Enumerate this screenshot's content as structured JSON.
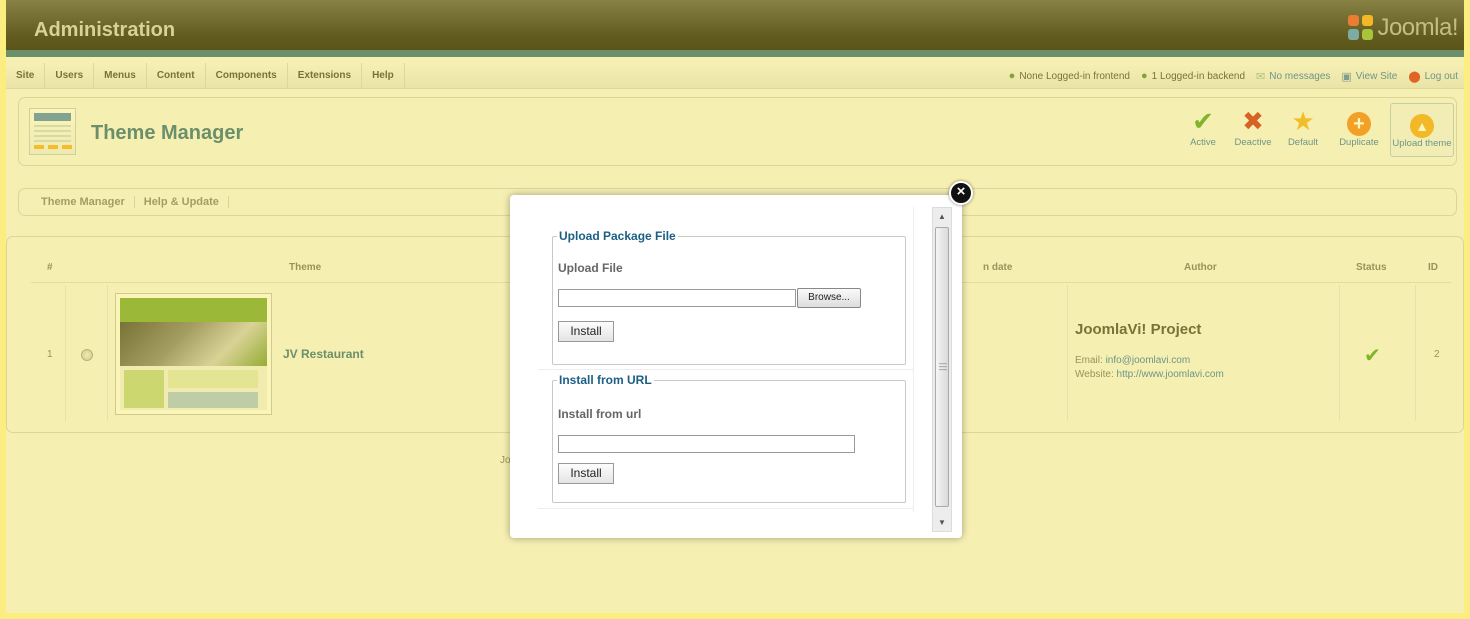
{
  "header": {
    "title": "Administration",
    "logo_text": "Joomla!"
  },
  "menu": {
    "items": [
      "Site",
      "Users",
      "Menus",
      "Content",
      "Components",
      "Extensions",
      "Help"
    ]
  },
  "status_bar": {
    "frontend": "None Logged-in frontend",
    "backend": "1 Logged-in backend",
    "messages": "No messages",
    "view_site": "View Site",
    "logout": "Log out"
  },
  "toolbar": {
    "title": "Theme Manager",
    "buttons": [
      {
        "label": "Active",
        "icon": "checkmark-icon"
      },
      {
        "label": "Deactive",
        "icon": "cross-icon"
      },
      {
        "label": "Default",
        "icon": "star-icon"
      },
      {
        "label": "Duplicate",
        "icon": "plus-circle-icon"
      },
      {
        "label": "Upload theme",
        "icon": "upload-circle-icon"
      }
    ]
  },
  "submenu": {
    "items": [
      "Theme Manager",
      "Help & Update"
    ]
  },
  "table": {
    "headers": {
      "num": "#",
      "theme": "Theme",
      "date": "n date",
      "author": "Author",
      "status": "Status",
      "id": "ID"
    },
    "rows": [
      {
        "num": "1",
        "theme": "JV Restaurant",
        "author": "JoomlaVi! Project",
        "email_label": "Email:",
        "email": "info@joomlavi.com",
        "website_label": "Website:",
        "website": "http://www.joomlavi.com",
        "id": "2"
      }
    ]
  },
  "footer": {
    "fragment": "Jo"
  },
  "modal": {
    "upload_legend": "Upload Package File",
    "upload_label": "Upload File",
    "browse_label": "Browse...",
    "install_label": "Install",
    "url_legend": "Install from URL",
    "url_label": "Install from url",
    "url_install_label": "Install",
    "close_glyph": "×"
  },
  "colors": {
    "brand": "#1b5f84",
    "link": "#1e6ab0",
    "active": "#3c9a22",
    "deactive": "#c41a1a",
    "default": "#f0a91e",
    "duplicate": "#ef7d1a"
  }
}
